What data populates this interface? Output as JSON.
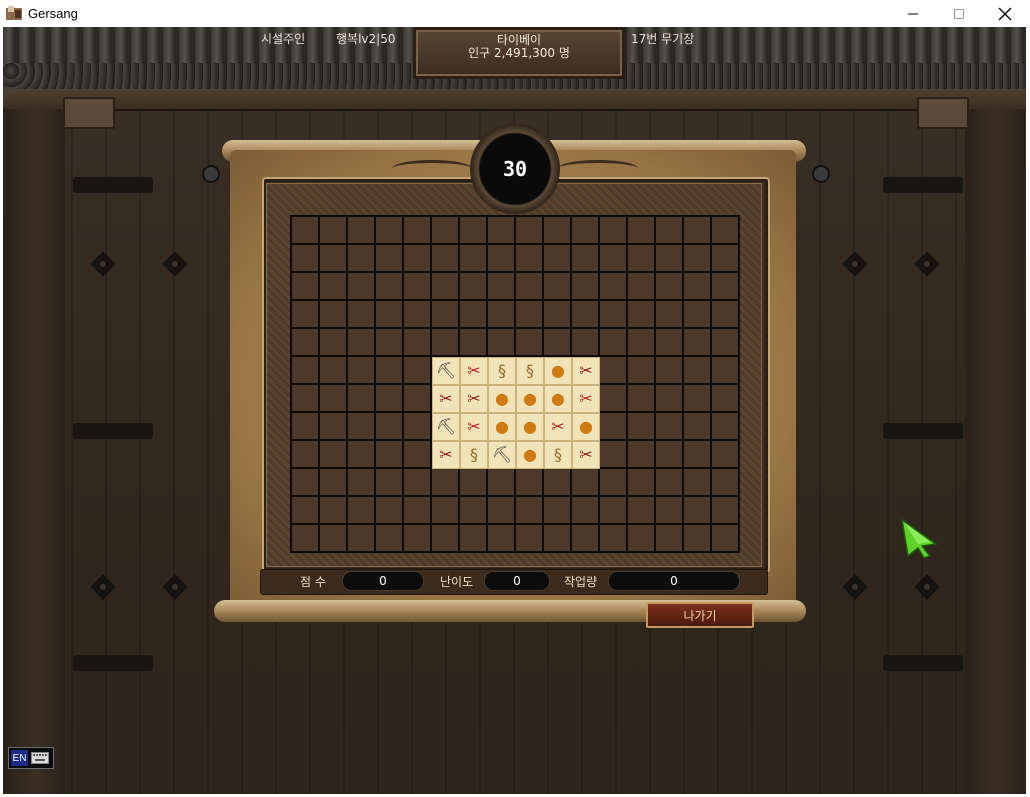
{
  "window": {
    "title": "Gersang",
    "minimize_icon": "minimize-icon",
    "maximize_icon": "maximize-icon",
    "close_icon": "close-icon"
  },
  "status": {
    "role": "시설주인",
    "happiness": "행복lv2|50",
    "city_name": "타이베이",
    "population": "인구 2,491,300 명",
    "facility": "17번 무기장"
  },
  "minigame": {
    "timer": "30",
    "grid_rows": 12,
    "grid_cols": 16,
    "score_label": "점 수",
    "score_value": "0",
    "difficulty_label": "난이도",
    "difficulty_value": "0",
    "workload_label": "작업량",
    "workload_value": "0",
    "exit_label": "나가기",
    "tiles": [
      [
        "pickaxe",
        "pliers-meat",
        "sack",
        "sack",
        "orange",
        "pliers"
      ],
      [
        "pliers",
        "pliers",
        "orange",
        "orange",
        "orange",
        "pliers-meat"
      ],
      [
        "pickaxe",
        "pliers-meat",
        "orange",
        "orange",
        "pliers-meat",
        "orange"
      ],
      [
        "pliers",
        "sack",
        "pickaxe",
        "orange",
        "sack",
        "pliers"
      ]
    ]
  },
  "ime": {
    "mode": "EN"
  },
  "colors": {
    "tile_bg": "#f1e4b8",
    "board_grid": "#4b3a2c",
    "exit_button": "#7a2e1c",
    "cursor": "#5fd12a"
  }
}
